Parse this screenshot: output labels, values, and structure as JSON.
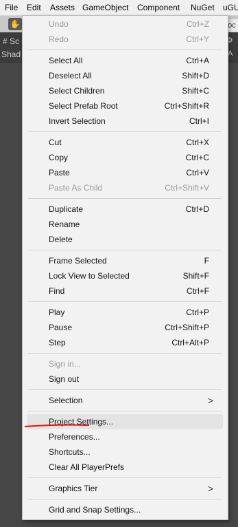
{
  "menubar": {
    "items": [
      "File",
      "Edit",
      "Assets",
      "GameObject",
      "Component",
      "NuGet",
      "uGU"
    ]
  },
  "background": {
    "scene_tab": "# Sc",
    "shading_label": "Shad",
    "right_tab": "Loc",
    "right_icon": "A"
  },
  "edit_menu": {
    "items": [
      {
        "label": "Undo",
        "shortcut": "Ctrl+Z"
      },
      {
        "label": "Redo",
        "shortcut": "Ctrl+Y"
      },
      {
        "label": "Select All",
        "shortcut": "Ctrl+A"
      },
      {
        "label": "Deselect All",
        "shortcut": "Shift+D"
      },
      {
        "label": "Select Children",
        "shortcut": "Shift+C"
      },
      {
        "label": "Select Prefab Root",
        "shortcut": "Ctrl+Shift+R"
      },
      {
        "label": "Invert Selection",
        "shortcut": "Ctrl+I"
      },
      {
        "label": "Cut",
        "shortcut": "Ctrl+X"
      },
      {
        "label": "Copy",
        "shortcut": "Ctrl+C"
      },
      {
        "label": "Paste",
        "shortcut": "Ctrl+V"
      },
      {
        "label": "Paste As Child",
        "shortcut": "Ctrl+Shift+V"
      },
      {
        "label": "Duplicate",
        "shortcut": "Ctrl+D"
      },
      {
        "label": "Rename",
        "shortcut": ""
      },
      {
        "label": "Delete",
        "shortcut": ""
      },
      {
        "label": "Frame Selected",
        "shortcut": "F"
      },
      {
        "label": "Lock View to Selected",
        "shortcut": "Shift+F"
      },
      {
        "label": "Find",
        "shortcut": "Ctrl+F"
      },
      {
        "label": "Play",
        "shortcut": "Ctrl+P"
      },
      {
        "label": "Pause",
        "shortcut": "Ctrl+Shift+P"
      },
      {
        "label": "Step",
        "shortcut": "Ctrl+Alt+P"
      },
      {
        "label": "Sign in...",
        "shortcut": ""
      },
      {
        "label": "Sign out",
        "shortcut": ""
      },
      {
        "label": "Selection",
        "shortcut": ""
      },
      {
        "label": "Project Settings...",
        "shortcut": ""
      },
      {
        "label": "Preferences...",
        "shortcut": ""
      },
      {
        "label": "Shortcuts...",
        "shortcut": ""
      },
      {
        "label": "Clear All PlayerPrefs",
        "shortcut": ""
      },
      {
        "label": "Graphics Tier",
        "shortcut": ""
      },
      {
        "label": "Grid and Snap Settings...",
        "shortcut": ""
      }
    ],
    "submenu_arrow": ">",
    "colors": {
      "annotation_underline": "#e02020",
      "highlight": "#e4e4e4"
    }
  }
}
